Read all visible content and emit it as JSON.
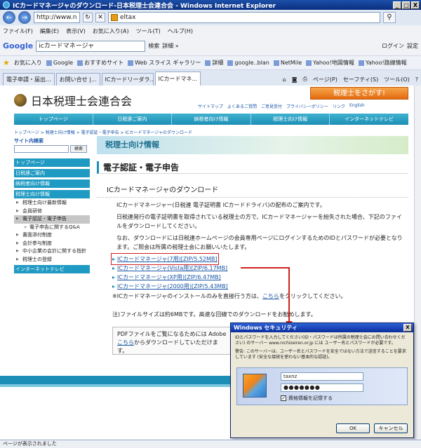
{
  "window": {
    "title": "ICカードマネージャのダウンロード-日本税理士会連合会 - Windows Internet Explorer",
    "min": "_",
    "max": "□",
    "close": "X"
  },
  "addressbar": {
    "url": "http://www.n",
    "search_value": "eltax",
    "back": "←",
    "fwd": "→"
  },
  "menu": [
    "ファイル(F)",
    "編集(E)",
    "表示(V)",
    "お気に入り(A)",
    "ツール(T)",
    "ヘルプ(H)"
  ],
  "google": {
    "logo": "Google",
    "query": "icカードマネージャ",
    "search_label": "検索",
    "more": "詳細 »",
    "login": "ログイン",
    "settings": "設定"
  },
  "favorites": {
    "label": "お気に入り",
    "items": [
      "Google",
      "おすすめサイト",
      "Web スライス ギャラリー",
      "詳細",
      "google..blan",
      "NetMile",
      "Yahoo!地図情報",
      "Yahoo!路線情報"
    ]
  },
  "tabs": [
    "電子申請・届出...",
    "お問い合せ |...",
    "ICカードリーダラ...",
    "ICカードマネ..."
  ],
  "tabtools": [
    "ページ(P)",
    "セーフティ(S)",
    "ツール(O)"
  ],
  "site": {
    "title": "日本税理士会連合会",
    "cta": "税理士をさがす!",
    "utility": [
      "サイトマップ",
      "よくあるご質問",
      "ご意見受付",
      "プライバシーポリシー",
      "リンク",
      "English"
    ],
    "gnav": [
      "トップページ",
      "日税連ご案内",
      "納税者向け情報",
      "税理士向け情報",
      "インターネットテレビ"
    ],
    "breadcrumb": "トップページ > 税理士向け情報 > 電子認証・電子申告 > ICカードマネージャのダウンロード"
  },
  "sidebar": {
    "search_label": "サイト内検索",
    "search_btn": "検索",
    "cats": [
      "トップページ",
      "日税連ご案内",
      "納税者向け情報",
      "税理士向け情報"
    ],
    "subs": [
      "税理士向け最新情報",
      "会員研修",
      "電子認証・電子申告"
    ],
    "subsubs": [
      "電子申告に関するQ&A"
    ],
    "subs2": [
      "書面添付制度",
      "会計参与制度",
      "中小企業の会計に関する指針",
      "税理士の登録"
    ],
    "tv": "インターネットテレビ"
  },
  "main": {
    "banner": "税理士向け情報",
    "h2": "電子認証・電子申告",
    "h3": "ICカードマネージャのダウンロード",
    "p1": "ICカードマネージャー(日税連 電子証明書 ICカードドライバ)の配布のご案内です。",
    "p2": "日税連発行の電子証明書を取得されている税理士の方で、ICカードマネージャーを紛失された場合、下記のファイルをダウンロードしてください。",
    "p3": "なお、ダウンロードには日税連ホームページの会員専用ページにログインするためのIDとパスワードが必要となります。ご照会は所属の税理士会にお願いいたします。",
    "links": [
      "ICカードマネージャ(7用)[ZIP/5.52MB]",
      "ICカードマネージャ(Vista用)[ZIP/6.17MB]",
      "ICカードマネージャ(XP用)[ZIP/6.47MB]",
      "ICカードマネージャ(2000用)[ZIP/5.43MB]"
    ],
    "note_pre": "※ICカードマネージャのインストールのみを直接行う方は、",
    "note_link": "こちら",
    "note_post": "をクリックしてください。",
    "filesize": "注)ファイルサイズは約6MBです。高速な回線でのダウンロードをお勧めします。",
    "pdf_line1": "PDFファイルをご覧になるためには Adobe",
    "pdf_link": "こちら",
    "pdf_line2": "からダウンロードしていただけます。"
  },
  "status": "ページが表示されました",
  "dialog": {
    "title": "Windows セキュリティ",
    "close": "X",
    "msg": "IDとパスワードを入力してください(ID・パスワードは所属の税理士会にお問い合わせください) のサーバー www.nichizeiren.or.jp には ユーザー名とパスワードが必要です。",
    "warn": "警告: このサーバーは、ユーザー名とパスワードを安全ではない方法で送信することを要求しています (安全な接続を使わない基本的な認証)。",
    "username": "taxnz",
    "password": "●●●●●●●",
    "remember": "資格情報を記憶する",
    "ok": "OK",
    "cancel": "キャンセル"
  }
}
